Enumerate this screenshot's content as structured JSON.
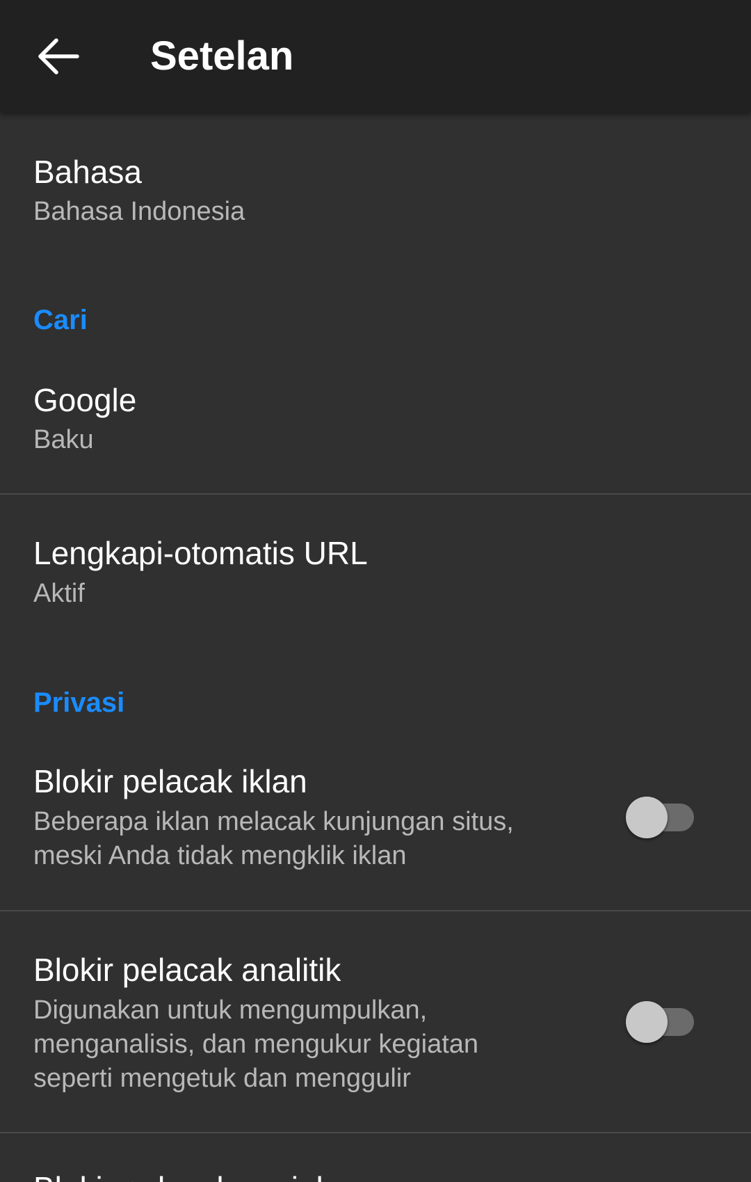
{
  "appbar": {
    "title": "Setelan",
    "back_icon": "arrow-back-icon"
  },
  "language": {
    "title": "Bahasa",
    "value": "Bahasa Indonesia"
  },
  "search_section": {
    "header": "Cari",
    "engine_title": "Google",
    "engine_value": "Baku",
    "autocomplete_title": "Lengkapi-otomatis URL",
    "autocomplete_value": "Aktif"
  },
  "privacy_section": {
    "header": "Privasi",
    "ad_trackers": {
      "title": "Blokir pelacak iklan",
      "line1": "Beberapa iklan melacak kunjungan situs,",
      "line2": "meski Anda tidak mengklik iklan",
      "enabled": false
    },
    "analytics_trackers": {
      "title": "Blokir pelacak analitik",
      "line1": "Digunakan untuk mengumpulkan,",
      "line2": "menganalisis, dan mengukur kegiatan",
      "line3": "seperti mengetuk dan menggulir",
      "enabled": false
    },
    "next_item_partial": "Blokir pelacak sosial"
  },
  "colors": {
    "appbar_bg": "#212121",
    "page_bg": "#303030",
    "accent": "#1a8cff",
    "primary_text": "#ffffff",
    "secondary_text": "#b8b8b8",
    "divider": "#4a4a4a"
  }
}
